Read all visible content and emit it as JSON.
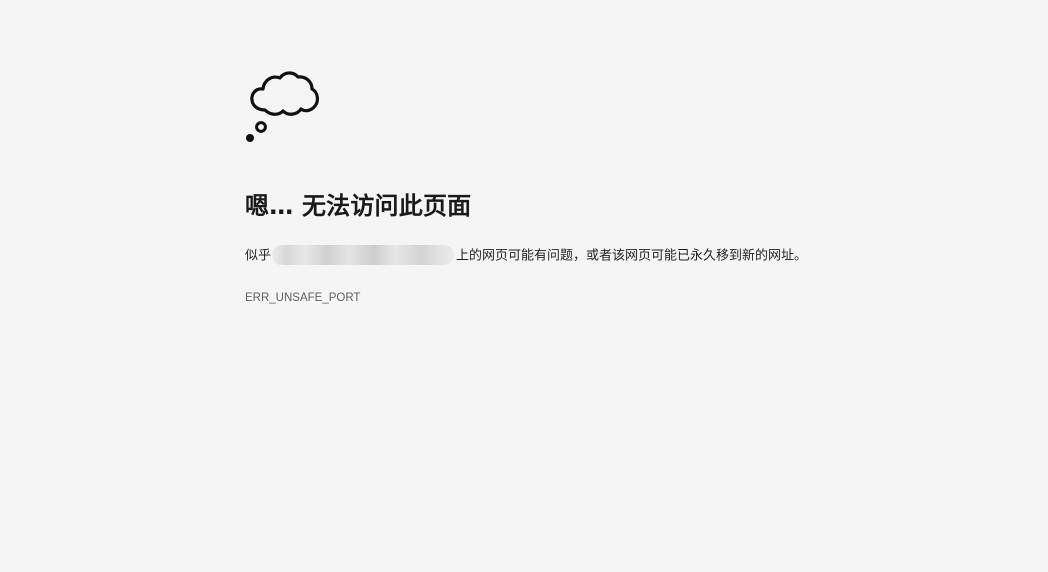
{
  "icon": "thought-cloud-icon",
  "colors": {
    "background": "#f5f5f5",
    "text": "#1a1a1a",
    "secondary_text": "#5f5f5f"
  },
  "error": {
    "title": "嗯… 无法访问此页面",
    "message_prefix": "似乎",
    "message_suffix": "上的网页可能有问题，或者该网页可能已永久移到新的网址。",
    "code": "ERR_UNSAFE_PORT"
  }
}
